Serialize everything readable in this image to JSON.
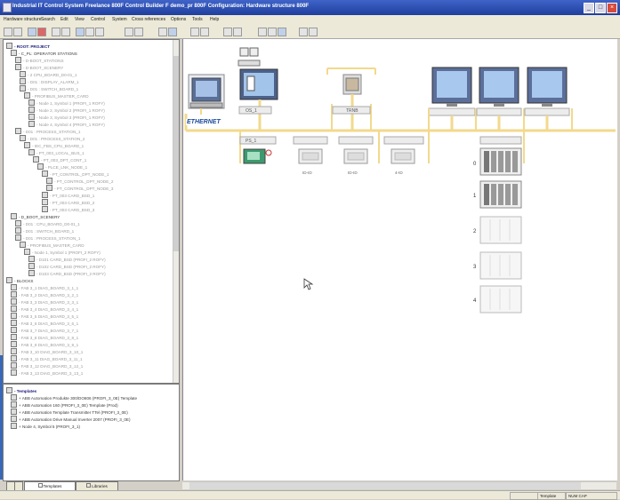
{
  "window": {
    "title": "Industrial IT Control System Freelance 800F Control Builder F demo_pr 800F Configuration: Hardware structure 800F",
    "controls": {
      "minimize": "_",
      "maximize": "□",
      "close": "×"
    }
  },
  "menubar": [
    {
      "label": "Hardware structure"
    },
    {
      "label": "Search"
    },
    {
      "label": "Edit"
    },
    {
      "label": "View"
    },
    {
      "label": "Control"
    },
    {
      "label": "System"
    },
    {
      "label": "Cross references"
    },
    {
      "label": "Options"
    },
    {
      "label": "Tools"
    },
    {
      "label": "Help"
    }
  ],
  "toolbar": {
    "buttons": [
      "new",
      "open",
      "save",
      "print",
      "cut",
      "copy",
      "paste",
      "undo",
      "redo",
      "commission",
      "download",
      "zoom-in",
      "zoom-out",
      "properties",
      "help"
    ]
  },
  "project_tree": [
    {
      "level": 0,
      "icon": "plant",
      "text": "- ROOT: PROJECT",
      "style": "hi"
    },
    {
      "level": 1,
      "icon": "unit",
      "text": "- C_PL: OPERATOR STATIONS",
      "style": "normal"
    },
    {
      "level": 2,
      "icon": "node",
      "text": "- D-BOOT_STATIONS",
      "style": "dim"
    },
    {
      "level": 2,
      "icon": "node",
      "text": "- D-BOOT_SCENERY",
      "style": "dim"
    },
    {
      "level": 3,
      "icon": "mod",
      "text": "- 2 CPU_BOARD_D0-01_1",
      "style": "dim"
    },
    {
      "level": 3,
      "icon": "mod",
      "text": "- D01 : DISPLAY_ALARM_1",
      "style": "dim"
    },
    {
      "level": 3,
      "icon": "mod",
      "text": "- D01 : SWITCH_BOARD_1",
      "style": "dim"
    },
    {
      "level": 4,
      "icon": "io",
      "text": "- PROFIBUS_MASTER_CARD",
      "style": "dim"
    },
    {
      "level": 5,
      "icon": "io",
      "text": "- Node 1, Symbol 1 (PROFI_1 ROFY)",
      "style": "dim"
    },
    {
      "level": 5,
      "icon": "io",
      "text": "- Node 2, Symbol 2 (PROFI_1 ROFY)",
      "style": "dim"
    },
    {
      "level": 5,
      "icon": "io",
      "text": "- Node 3, Symbol 3 (PROFI_1 ROFY)",
      "style": "dim"
    },
    {
      "level": 5,
      "icon": "io",
      "text": "- Node 4, Symbol 4 (PROFI_1 ROFY)",
      "style": "dim"
    },
    {
      "level": 2,
      "icon": "unit",
      "text": "- D01 : PROCESS_STATION_1",
      "style": "dim"
    },
    {
      "level": 3,
      "icon": "unit",
      "text": "- D01 : PROCESS_STATION_2",
      "style": "dim"
    },
    {
      "level": 4,
      "icon": "unit",
      "text": "- IEC_FBS_CPU_BOARD_1",
      "style": "dim"
    },
    {
      "level": 5,
      "icon": "unit",
      "text": "- PT_003_LOCAL_BUS_1",
      "style": "dim"
    },
    {
      "level": 6,
      "icon": "unit",
      "text": "- PT_003_DPT_CONT_1",
      "style": "dim"
    },
    {
      "level": 7,
      "icon": "unit",
      "text": "- PLCE_LNK_NODE_1",
      "style": "dim"
    },
    {
      "level": 8,
      "icon": "mod",
      "text": "- PT_CONTROL_DPT_NODE_1",
      "style": "dim"
    },
    {
      "level": 9,
      "icon": "mod",
      "text": "- PT_CONTROL_DPT_NODE_2",
      "style": "dim"
    },
    {
      "level": 9,
      "icon": "mod",
      "text": "- PT_CONTROL_DPT_NODE_3",
      "style": "dim"
    },
    {
      "level": 8,
      "icon": "mod",
      "text": "- PT_003 CARD_BSD_1",
      "style": "dim"
    },
    {
      "level": 8,
      "icon": "mod",
      "text": "- PT_003 CARD_BSD_2",
      "style": "dim"
    },
    {
      "level": 8,
      "icon": "mod",
      "text": "- PT_003 CARD_BSD_3",
      "style": "dim"
    },
    {
      "level": 1,
      "icon": "plant",
      "text": "- D_BOOT_SCENERY",
      "style": "normal"
    },
    {
      "level": 2,
      "icon": "unit",
      "text": "- D01 : CPU_BOARD_D0-01_1",
      "style": "dim"
    },
    {
      "level": 2,
      "icon": "unit",
      "text": "- D01 : SWITCH_BOARD_1",
      "style": "dim"
    },
    {
      "level": 2,
      "icon": "unit",
      "text": "- D01 : PROCESS_STATION_1",
      "style": "dim"
    },
    {
      "level": 3,
      "icon": "io",
      "text": "- PROFIBUS_MASTER_CARD",
      "style": "dim"
    },
    {
      "level": 4,
      "icon": "io",
      "text": "- Node 1, Symbol 1 (PROFI_2 ROFY)",
      "style": "dim"
    },
    {
      "level": 5,
      "icon": "mod",
      "text": "- D101 CARD_BSD (PROFI_2 ROFY)",
      "style": "dim"
    },
    {
      "level": 5,
      "icon": "mod",
      "text": "- D102 CARD_BSD (PROFI_2 ROFY)",
      "style": "dim"
    },
    {
      "level": 5,
      "icon": "mod",
      "text": "- D103 CARD_BSD (PROFI_2 ROFY)",
      "style": "dim"
    },
    {
      "level": 0,
      "icon": "blk",
      "text": "- BLOCKS",
      "style": "normal"
    },
    {
      "level": 1,
      "icon": "blk",
      "text": "- FAB 3_1 DIAG_BOARD_3_1_1",
      "style": "dim"
    },
    {
      "level": 1,
      "icon": "blk",
      "text": "- FAB 3_2 DIAG_BOARD_3_2_1",
      "style": "dim"
    },
    {
      "level": 1,
      "icon": "blk",
      "text": "- FAB 3_3 DIAG_BOARD_3_3_1",
      "style": "dim"
    },
    {
      "level": 1,
      "icon": "blk",
      "text": "- FAB 3_4 DIAG_BOARD_3_4_1",
      "style": "dim"
    },
    {
      "level": 1,
      "icon": "blk",
      "text": "- FAB 3_5 DIAG_BOARD_3_5_1",
      "style": "dim"
    },
    {
      "level": 1,
      "icon": "blk",
      "text": "- FAB 3_6 DIAG_BOARD_3_6_1",
      "style": "dim"
    },
    {
      "level": 1,
      "icon": "blk",
      "text": "- FAB 3_7 DIAG_BOARD_3_7_1",
      "style": "dim"
    },
    {
      "level": 1,
      "icon": "blk",
      "text": "- FAB 3_8 DIAG_BOARD_3_8_1",
      "style": "dim"
    },
    {
      "level": 1,
      "icon": "blk",
      "text": "- FAB 3_9 DIAG_BOARD_3_9_1",
      "style": "dim"
    },
    {
      "level": 1,
      "icon": "blk",
      "text": "- FAB 3_10 DIAG_BOARD_3_10_1",
      "style": "dim"
    },
    {
      "level": 1,
      "icon": "blk",
      "text": "- FAB 3_11 DIAG_BOARD_3_11_1",
      "style": "dim"
    },
    {
      "level": 1,
      "icon": "blk",
      "text": "- FAB 3_12 DIAG_BOARD_3_12_1",
      "style": "dim"
    },
    {
      "level": 1,
      "icon": "blk",
      "text": "- FAB 3_13 DIAG_BOARD_3_13_1",
      "style": "dim"
    }
  ],
  "templates_tree": [
    {
      "level": 0,
      "icon": "tmpl",
      "text": "- Templates",
      "style": "hi"
    },
    {
      "level": 1,
      "icon": "tmpl",
      "text": "+ ABB Automation Produkte 300/DO806 (PROFI_3_0E) Template",
      "style": "normal"
    },
    {
      "level": 1,
      "icon": "tmpl",
      "text": "+ ABB Automation 160 (PROFI_3_0E) Template (Prod)",
      "style": "normal"
    },
    {
      "level": 1,
      "icon": "tmpl",
      "text": "+ ABB Automation Template Transmitter TTel (PROFI_3_0E)",
      "style": "normal"
    },
    {
      "level": 1,
      "icon": "tmpl",
      "text": "+ ABB Automation Drive Manual Inverter 2007 (PROFI_3_0E)",
      "style": "normal"
    },
    {
      "level": 1,
      "icon": "tmpl",
      "text": "+ Node 4, Symbol 5 (PROFI_3_1)",
      "style": "normal"
    }
  ],
  "bottom_tabs": [
    {
      "label": "Templates",
      "active": true
    },
    {
      "label": "Libraries",
      "active": false
    }
  ],
  "canvas": {
    "network_label": "ETHERNET",
    "stations": [
      {
        "id": "es",
        "label": ""
      },
      {
        "id": "os1",
        "label": "OS_1"
      },
      {
        "id": "gw",
        "label": "TRNB"
      },
      {
        "id": "mon1",
        "label": ""
      },
      {
        "id": "mon2",
        "label": ""
      },
      {
        "id": "mon3",
        "label": ""
      }
    ],
    "process_station": "PS_1",
    "io_units": [
      {
        "label": "ID-ID"
      },
      {
        "label": "ID-ID"
      },
      {
        "label": "4-ID"
      }
    ],
    "rack_numbers": [
      "0",
      "1",
      "2",
      "3",
      "4"
    ]
  },
  "statusbar": {
    "panes": [
      "",
      "Template",
      "NUM CAP"
    ]
  },
  "colors": {
    "ethernet_line": "#f2d98c",
    "network_label": "#1a4a9a",
    "titlebar": "#2f53b8",
    "canvas_bg": "#ffffff"
  }
}
